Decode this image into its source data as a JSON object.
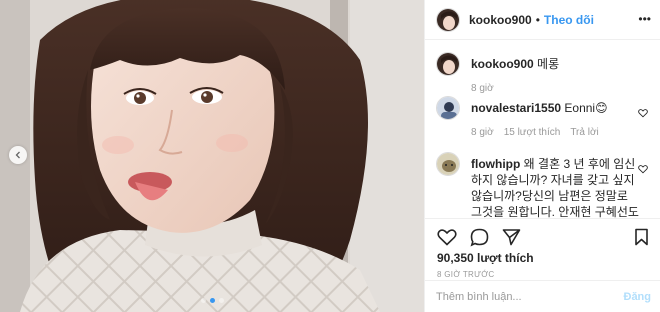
{
  "post": {
    "photo_alt": "",
    "dots_total": 3,
    "dot_active": 1
  },
  "header": {
    "username": "kookoo900",
    "separator": "•",
    "follow_label": "Theo dõi",
    "more_label": "•••"
  },
  "comments": [
    {
      "username": "kookoo900",
      "text": "메롱",
      "time": "8 giờ",
      "likes": "",
      "reply": ""
    },
    {
      "username": "novalestari1550",
      "text": "Eonni😊",
      "time": "8 giờ",
      "likes": "15 lượt thích",
      "reply": "Trả lời"
    },
    {
      "username": "flowhipp",
      "text": "왜 결혼 3 년 후에 임신하지 않습니까? 자녀를 갖고 싶지 않습니까?당신의 남편은 정말로 그것을 원합니다. 안재현 구혜선도",
      "time": "",
      "likes": "",
      "reply": ""
    }
  ],
  "stats": {
    "likes": "90,350 lượt thích",
    "timestamp": "8 GIỜ TRƯỚC"
  },
  "composer": {
    "placeholder": "Thêm bình luận...",
    "post_label": "Đăng"
  },
  "colors": {
    "link_blue": "#3897f0",
    "post_disabled": "#b2dffc",
    "muted": "#999999",
    "border": "#efefef"
  }
}
